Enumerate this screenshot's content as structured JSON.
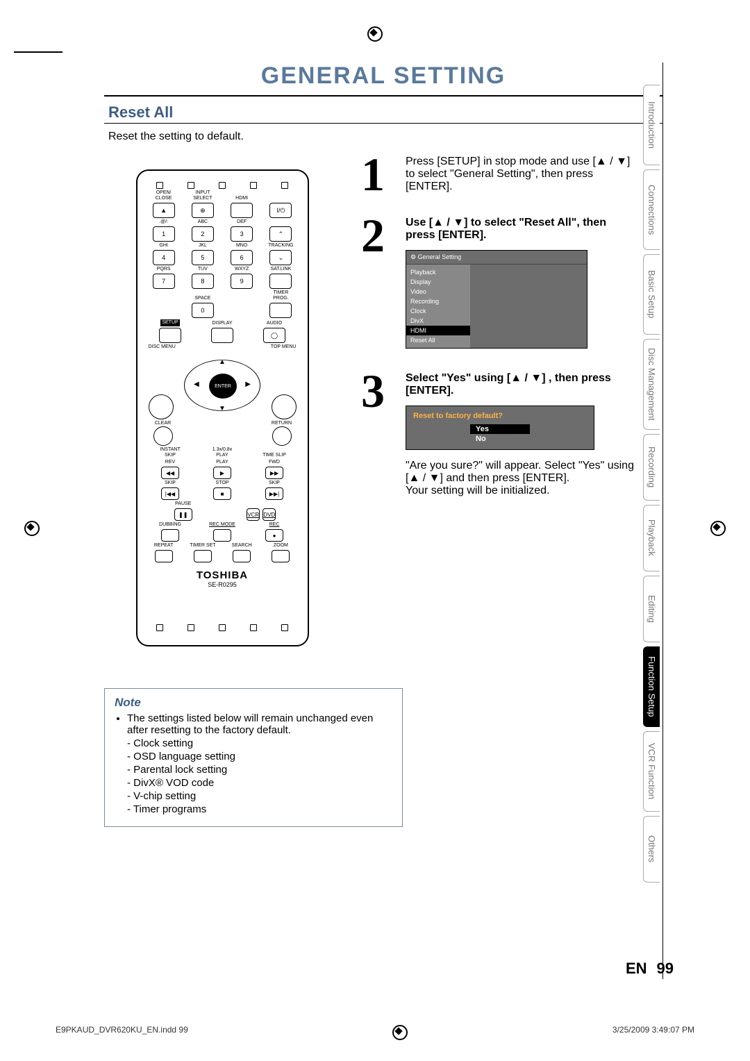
{
  "title": "GENERAL SETTING",
  "section": "Reset All",
  "intro": "Reset the setting to default.",
  "remote": {
    "top_labels": [
      "OPEN/\nCLOSE",
      "INPUT\nSELECT",
      "HDMI",
      ""
    ],
    "power_sym": "I/⏻",
    "eject_sym": "▲",
    "row2_labels": [
      ".@/:",
      "ABC",
      "DEF"
    ],
    "nums1": [
      "1",
      "2",
      "3"
    ],
    "row3_labels": [
      "GHI",
      "JKL",
      "MNO",
      "TRACKING"
    ],
    "nums2": [
      "4",
      "5",
      "6"
    ],
    "row4_labels": [
      "PQRS",
      "TUV",
      "WXYZ",
      "SAT.LINK"
    ],
    "nums3": [
      "7",
      "8",
      "9"
    ],
    "space": "SPACE",
    "zero": "0",
    "timer_prog": "TIMER\nPROG.",
    "setup": "SETUP",
    "display": "DISPLAY",
    "audio": "AUDIO",
    "disc_menu": "DISC MENU",
    "top_menu": "TOP MENU",
    "enter": "ENTER",
    "clear": "CLEAR",
    "return": "RETURN",
    "instant_skip": "INSTANT\nSKIP",
    "play_13": "1.3x/0.8x\nPLAY",
    "time_slip": "TIME SLIP",
    "rev": "REV",
    "play": "PLAY",
    "fwd": "FWD",
    "skip_l": "SKIP",
    "stop": "STOP",
    "skip_r": "SKIP",
    "pause": "PAUSE",
    "vcr": "VCR",
    "dvd": "DVD",
    "dubbing": "DUBBING",
    "rec_mode": "REC MODE",
    "rec": "REC",
    "repeat": "REPEAT",
    "timer_set": "TIMER SET",
    "search": "SEARCH",
    "zoom": "ZOOM",
    "brand": "TOSHIBA",
    "model": "SE-R0295"
  },
  "steps": {
    "s1": "Press [SETUP] in stop mode and use [▲ / ▼] to select \"General Setting\", then press [ENTER].",
    "s2": "Use [▲ / ▼] to select \"Reset All\", then press [ENTER].",
    "s3": "Select \"Yes\" using [▲ / ▼] , then press [ENTER].",
    "s3_after1": "\"Are you sure?\" will appear. Select \"Yes\" using",
    "s3_after2": "[▲ / ▼] and then press [ENTER].",
    "s3_after3": "Your setting will be initialized."
  },
  "osd": {
    "header_icon": "⚙",
    "header": "General Setting",
    "items": [
      "Playback",
      "Display",
      "Video",
      "Recording",
      "Clock",
      "DivX",
      "HDMI",
      "Reset All"
    ],
    "hl_index": 6
  },
  "osd2": {
    "question": "Reset to factory default?",
    "yes": "Yes",
    "no": "No"
  },
  "note": {
    "title": "Note",
    "lead": "The settings listed below will remain unchanged even after resetting to the factory default.",
    "items": [
      "Clock setting",
      "OSD language setting",
      "Parental lock setting",
      "DivX® VOD code",
      "V-chip setting",
      "Timer programs"
    ]
  },
  "tabs": [
    {
      "label": "Introduction",
      "active": false
    },
    {
      "label": "Connections",
      "active": false
    },
    {
      "label": "Basic Setup",
      "active": false
    },
    {
      "label": "Disc\nManagement",
      "active": false
    },
    {
      "label": "Recording",
      "active": false
    },
    {
      "label": "Playback",
      "active": false
    },
    {
      "label": "Editing",
      "active": false
    },
    {
      "label": "Function Setup",
      "active": true
    },
    {
      "label": "VCR Function",
      "active": false
    },
    {
      "label": "Others",
      "active": false
    }
  ],
  "footer": {
    "lang": "EN",
    "page": "99",
    "file": "E9PKAUD_DVR620KU_EN.indd   99",
    "timestamp": "3/25/2009   3:49:07 PM"
  }
}
